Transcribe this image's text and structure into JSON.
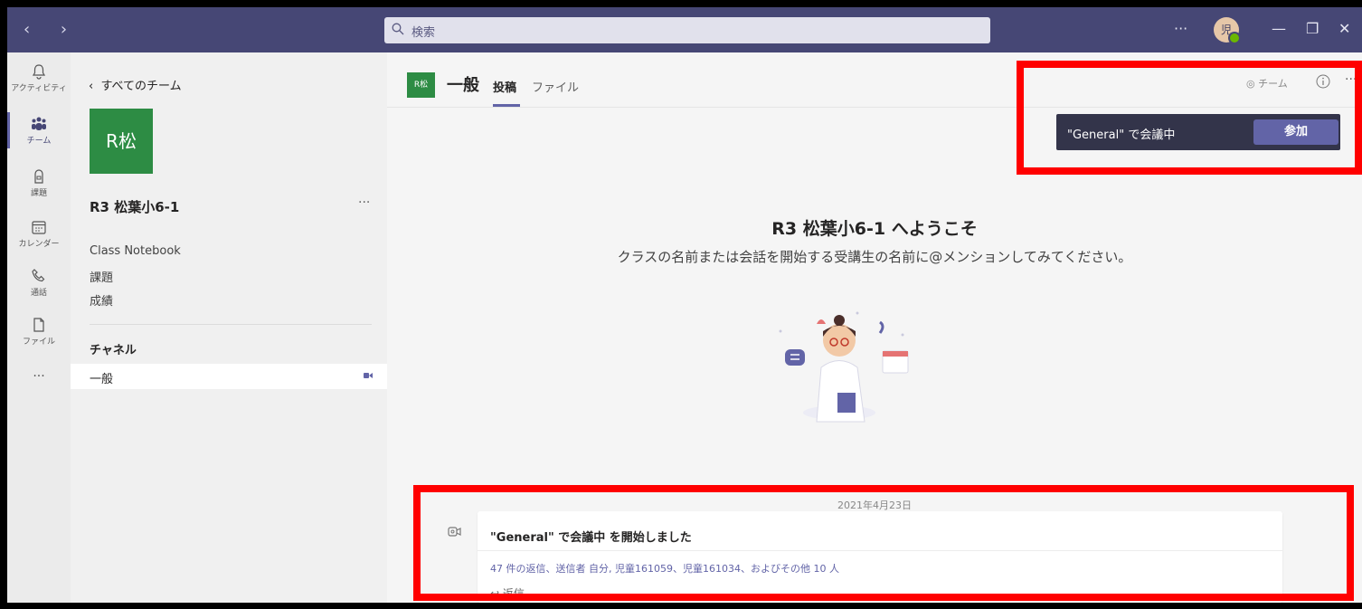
{
  "titlebar": {
    "search_placeholder": "検索",
    "more_label": "···",
    "avatar_text": "児",
    "minimize_label": "—",
    "restore_label": "❐",
    "close_label": "✕"
  },
  "rail": {
    "items": [
      {
        "label": "アクティビティ"
      },
      {
        "label": "チーム"
      },
      {
        "label": "課題"
      },
      {
        "label": "カレンダー"
      },
      {
        "label": "通話"
      },
      {
        "label": "ファイル"
      }
    ],
    "more_label": "···"
  },
  "team_pane": {
    "back_label": "すべてのチーム",
    "tile_text": "R松",
    "team_name": "R3 松葉小6-1",
    "team_more": "···",
    "links": [
      "Class Notebook",
      "課題",
      "成績"
    ],
    "channels_heading": "チャネル",
    "channel_name": "一般"
  },
  "channel": {
    "avatar_text": "R松",
    "title": "一般",
    "tabs": [
      "投稿",
      "ファイル"
    ],
    "team_label": "チーム",
    "more_label": "···"
  },
  "meeting_banner": {
    "text": "\"General\" で会議中",
    "join_label": "参加"
  },
  "welcome": {
    "title": "R3 松葉小6-1 へようこそ",
    "subtitle": "クラスの名前または会話を開始する受講生の名前に@メンションしてみてください。"
  },
  "message": {
    "date": "2021年4月23日",
    "title": "\"General\" で会議中 を開始しました",
    "replies": "47 件の返信、送信者 自分, 児童161059、児童161034、およびその他 10 人",
    "reply_label": "返信"
  },
  "colors": {
    "titlebar": "#464775",
    "accent": "#6264a7",
    "team_tile": "#2d8c44",
    "highlight": "#ff0000"
  }
}
